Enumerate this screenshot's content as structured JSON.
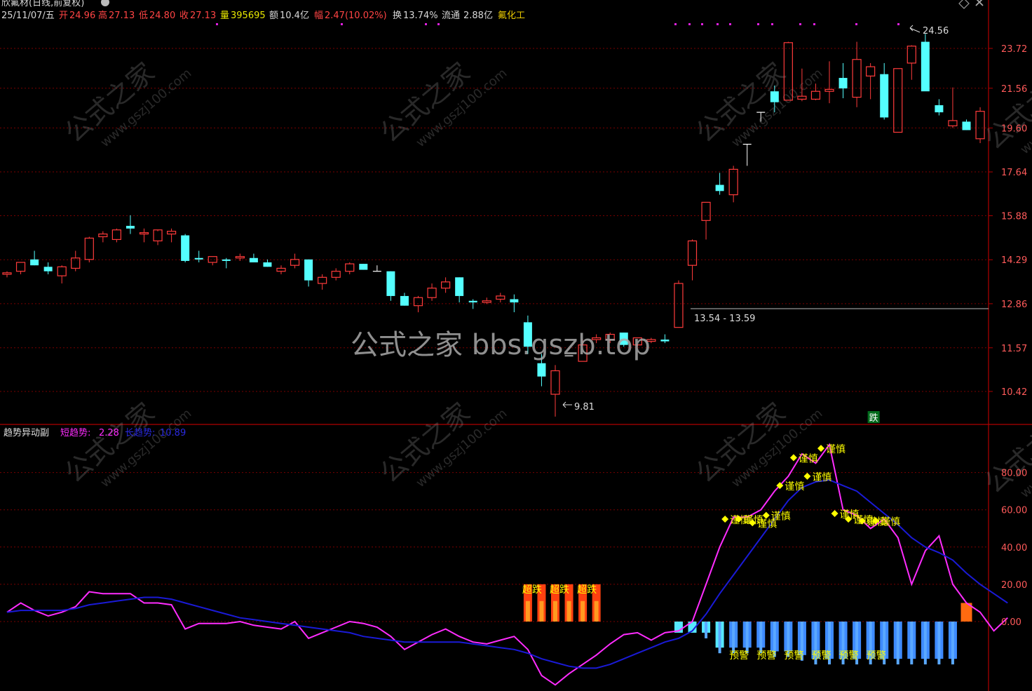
{
  "header": {
    "stock_title": "欣氟材(日线,前复权)",
    "date": "25/11/07/五",
    "open_label": "开",
    "open": "24.96",
    "high_label": "高",
    "high": "27.13",
    "low_label": "低",
    "low": "24.80",
    "close_label": "收",
    "close": "27.13",
    "volume_label": "量",
    "volume": "395695",
    "amount_label": "额",
    "amount": "10.4亿",
    "amp_label": "幅",
    "amp": "2.47(10.02%)",
    "turnover_label": "换",
    "turnover": "13.74%",
    "float_label": "流通",
    "float_value": "2.88亿",
    "sector": "氟化工"
  },
  "indicator": {
    "name": "趋势异动副",
    "short_label": "短趋势:",
    "short_value": "2.28",
    "long_label": "长趋势:",
    "long_value": "10.89"
  },
  "watermarks": {
    "center": "公式之家 bbs.gszb.top",
    "tile_cn": "公式之家",
    "tile_url": "www.gszj100.com"
  },
  "signals": {
    "caution": "谨慎",
    "warning": "预警",
    "oversold": "超跌",
    "drop": "跌"
  },
  "colors": {
    "background": "#000000",
    "up": "#ff3b3b",
    "down": "#54ffff",
    "grid": "#7a0000",
    "short_trend": "#ff2cff",
    "long_trend": "#1a1ad6",
    "caution": "#ffff00",
    "warning_bar": "#3e8bff",
    "oversold_bar": "#ff4010",
    "drop_box": "#006b1c"
  },
  "chart_data": [
    {
      "type": "candlestick",
      "y_ticks": [
        "23.72",
        "21.56",
        "19.60",
        "17.64",
        "15.88",
        "14.29",
        "12.86",
        "11.57",
        "10.42"
      ],
      "high_annotation": "24.56",
      "low_annotation": "9.81",
      "range_annotation": "13.54 - 13.59",
      "candles": [
        [
          13.8,
          13.9,
          13.7,
          13.85
        ],
        [
          13.9,
          14.2,
          13.8,
          14.2
        ],
        [
          14.3,
          14.6,
          14.1,
          14.1
        ],
        [
          14.05,
          14.2,
          13.8,
          13.9
        ],
        [
          13.75,
          14.1,
          13.5,
          14.05
        ],
        [
          14.0,
          14.6,
          13.9,
          14.35
        ],
        [
          14.3,
          15.1,
          14.2,
          15.05
        ],
        [
          15.1,
          15.3,
          14.9,
          15.2
        ],
        [
          15.0,
          15.4,
          14.9,
          15.35
        ],
        [
          15.5,
          15.9,
          15.2,
          15.4
        ],
        [
          15.2,
          15.4,
          14.9,
          15.25
        ],
        [
          14.95,
          15.3,
          14.8,
          15.35
        ],
        [
          15.2,
          15.4,
          14.9,
          15.3
        ],
        [
          15.15,
          15.2,
          14.2,
          14.25
        ],
        [
          14.35,
          14.6,
          14.2,
          14.3
        ],
        [
          14.2,
          14.4,
          14.1,
          14.4
        ],
        [
          14.3,
          14.35,
          14.0,
          14.25
        ],
        [
          14.35,
          14.5,
          14.25,
          14.4
        ],
        [
          14.35,
          14.5,
          14.2,
          14.2
        ],
        [
          14.2,
          14.3,
          14.05,
          14.05
        ],
        [
          13.9,
          14.1,
          13.8,
          14.0
        ],
        [
          14.1,
          14.5,
          14.0,
          14.3
        ],
        [
          14.3,
          14.3,
          13.4,
          13.6
        ],
        [
          13.5,
          13.8,
          13.3,
          13.7
        ],
        [
          13.7,
          14.0,
          13.6,
          13.9
        ],
        [
          13.9,
          14.2,
          13.8,
          14.15
        ],
        [
          14.15,
          14.15,
          13.95,
          13.95
        ],
        [
          13.9,
          14.1,
          13.9,
          13.9
        ],
        [
          13.9,
          13.9,
          12.95,
          13.1
        ],
        [
          13.1,
          13.2,
          12.8,
          12.8
        ],
        [
          12.8,
          13.1,
          12.6,
          13.05
        ],
        [
          13.05,
          13.5,
          12.95,
          13.35
        ],
        [
          13.35,
          13.7,
          13.2,
          13.55
        ],
        [
          13.7,
          13.7,
          12.9,
          13.1
        ],
        [
          12.95,
          13.0,
          12.7,
          12.9
        ],
        [
          12.9,
          13.05,
          12.85,
          12.95
        ],
        [
          13.0,
          13.2,
          12.9,
          13.1
        ],
        [
          13.0,
          13.15,
          12.6,
          12.9
        ],
        [
          12.3,
          12.5,
          11.4,
          11.6
        ],
        [
          11.15,
          11.4,
          10.55,
          10.8
        ],
        [
          10.35,
          11.1,
          9.81,
          10.95
        ],
        [
          11.35,
          11.35,
          11.35,
          11.35
        ],
        [
          11.2,
          11.8,
          11.2,
          11.65
        ],
        [
          11.8,
          11.95,
          11.7,
          11.85
        ],
        [
          11.8,
          12.0,
          11.7,
          11.95
        ],
        [
          12.0,
          12.0,
          11.6,
          11.65
        ],
        [
          11.65,
          11.85,
          11.6,
          11.85
        ],
        [
          11.75,
          11.85,
          11.7,
          11.8
        ],
        [
          11.8,
          11.95,
          11.7,
          11.75
        ],
        [
          12.15,
          13.6,
          12.15,
          13.5
        ],
        [
          14.1,
          15.0,
          13.6,
          14.95
        ],
        [
          15.7,
          16.4,
          15.0,
          16.4
        ],
        [
          17.1,
          17.6,
          16.7,
          16.85
        ],
        [
          16.7,
          17.9,
          16.4,
          17.75
        ],
        [
          18.85,
          18.85,
          17.9,
          18.85
        ],
        [
          20.35,
          20.35,
          19.9,
          20.35
        ],
        [
          21.4,
          21.7,
          20.35,
          20.85
        ],
        [
          20.95,
          24.1,
          20.95,
          24.05
        ],
        [
          21.0,
          22.6,
          20.9,
          21.15
        ],
        [
          21.0,
          21.8,
          20.95,
          21.4
        ],
        [
          21.4,
          23.0,
          20.8,
          21.5
        ],
        [
          22.1,
          22.9,
          21.05,
          21.55
        ],
        [
          21.1,
          24.1,
          20.6,
          23.1
        ],
        [
          22.2,
          22.9,
          21.0,
          22.7
        ],
        [
          22.3,
          22.9,
          20.0,
          20.1
        ],
        [
          19.4,
          22.6,
          19.4,
          22.6
        ],
        [
          22.9,
          23.9,
          22.0,
          23.85
        ],
        [
          24.1,
          24.56,
          21.55,
          21.4
        ],
        [
          20.7,
          21.0,
          20.2,
          20.35
        ],
        [
          19.7,
          21.6,
          19.6,
          19.95
        ],
        [
          19.9,
          20.0,
          19.5,
          19.5
        ],
        [
          19.1,
          20.6,
          18.9,
          20.4
        ]
      ]
    },
    {
      "type": "line",
      "y_ticks": [
        "80.00",
        "60.00",
        "40.00",
        "20.00",
        "0.00"
      ],
      "series": [
        {
          "name": "短趋势",
          "values": [
            5,
            10,
            6,
            3,
            5,
            8,
            16,
            15,
            15,
            15,
            10,
            10,
            9,
            -4,
            -1,
            -1,
            -1,
            0,
            -2,
            -3,
            -4,
            0,
            -9,
            -6,
            -3,
            0,
            -1,
            -3,
            -8,
            -15,
            -11,
            -7,
            -4,
            -8,
            -11,
            -12,
            -10,
            -8,
            -15,
            -29,
            -34,
            -28,
            -23,
            -18,
            -12,
            -7,
            -6,
            -10,
            -6,
            -5,
            0,
            20,
            40,
            56,
            56,
            60,
            70,
            78,
            90,
            85,
            95,
            60,
            57,
            50,
            55,
            45,
            20,
            38,
            46,
            20,
            10,
            5,
            -5,
            2
          ]
        },
        {
          "name": "长趋势",
          "values": [
            5,
            6,
            6,
            6,
            6,
            7,
            9,
            10,
            11,
            12,
            13,
            13,
            12,
            10,
            8,
            6,
            4,
            2,
            1,
            0,
            -1,
            -2,
            -3,
            -4,
            -5,
            -6,
            -8,
            -9,
            -10,
            -11,
            -11,
            -11,
            -11,
            -11,
            -12,
            -13,
            -14,
            -15,
            -17,
            -20,
            -22,
            -24,
            -25,
            -25,
            -23,
            -20,
            -17,
            -14,
            -11,
            -9,
            -5,
            4,
            15,
            25,
            35,
            45,
            55,
            65,
            72,
            75,
            76,
            73,
            70,
            64,
            58,
            52,
            45,
            40,
            37,
            33,
            26,
            20,
            15,
            10
          ]
        }
      ],
      "caution_points": [
        [
          53,
          55
        ],
        [
          54,
          55
        ],
        [
          55,
          53
        ],
        [
          56,
          57
        ],
        [
          57,
          73
        ],
        [
          58,
          88
        ],
        [
          59,
          78
        ],
        [
          60,
          93
        ],
        [
          61,
          58
        ],
        [
          62,
          55
        ],
        [
          63,
          54
        ],
        [
          64,
          54
        ]
      ],
      "warning_bars": [
        [
          49,
          6
        ],
        [
          50,
          6
        ],
        [
          51,
          6
        ],
        [
          52,
          14
        ],
        [
          53,
          14
        ],
        [
          54,
          14
        ],
        [
          55,
          14
        ],
        [
          56,
          16
        ],
        [
          57,
          16
        ],
        [
          58,
          18
        ],
        [
          59,
          20
        ],
        [
          60,
          20
        ],
        [
          61,
          20
        ],
        [
          62,
          20
        ],
        [
          63,
          20
        ],
        [
          64,
          20
        ],
        [
          65,
          20
        ],
        [
          66,
          20
        ],
        [
          67,
          20
        ],
        [
          68,
          20
        ],
        [
          69,
          20
        ]
      ],
      "oversold_bars": [
        [
          38,
          20
        ],
        [
          39,
          20
        ],
        [
          40,
          20
        ],
        [
          41,
          20
        ],
        [
          42,
          20
        ],
        [
          43,
          20
        ]
      ],
      "orange_bar": [
        70,
        10
      ],
      "drop_marker_index": 63
    }
  ]
}
